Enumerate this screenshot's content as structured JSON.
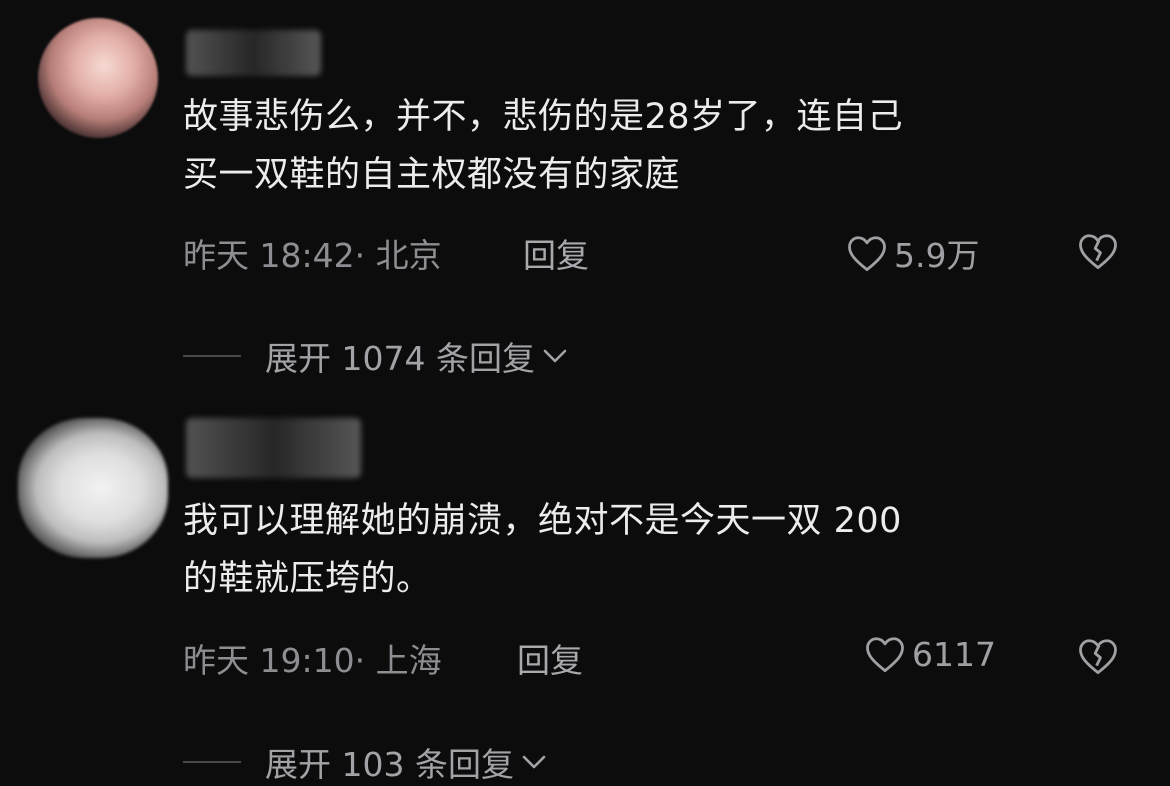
{
  "comments": [
    {
      "text_line1": "故事悲伤么，并不，悲伤的是28岁了，连自己",
      "text_line2": "买一双鞋的自主权都没有的家庭",
      "time_location": "昨天 18:42· 北京",
      "reply_label": "回复",
      "likes": "5.9万",
      "expand_label": "展开 1074 条回复"
    },
    {
      "text_line1": "我可以理解她的崩溃，绝对不是今天一双 200",
      "text_line2": "的鞋就压垮的。",
      "time_location": "昨天 19:10· 上海",
      "reply_label": "回复",
      "likes": "6117",
      "expand_label": "展开 103 条回复"
    }
  ],
  "icons": {
    "like": "heart-outline-icon",
    "dislike": "broken-heart-icon",
    "expand": "chevron-down-icon"
  },
  "colors": {
    "background": "#0c0c0d",
    "text": "#ececed",
    "meta": "#8e8e92"
  }
}
